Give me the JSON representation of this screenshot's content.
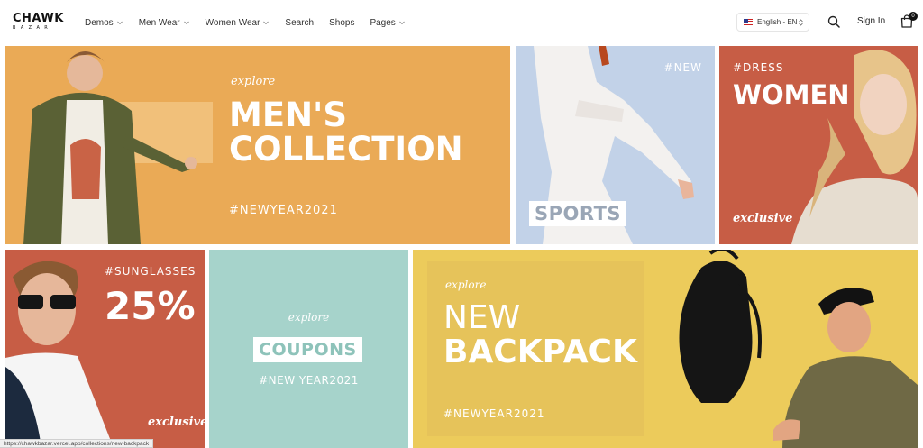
{
  "header": {
    "logo": {
      "line1": "CHAWK",
      "line2": "BAZAR"
    },
    "nav": [
      {
        "label": "Demos",
        "has_dropdown": true
      },
      {
        "label": "Men Wear",
        "has_dropdown": true
      },
      {
        "label": "Women Wear",
        "has_dropdown": true
      },
      {
        "label": "Search",
        "has_dropdown": false
      },
      {
        "label": "Shops",
        "has_dropdown": false
      },
      {
        "label": "Pages",
        "has_dropdown": true
      }
    ],
    "language": {
      "selected": "English - EN",
      "flag_icon": "us-flag-icon"
    },
    "search_icon": "search-icon",
    "sign_in_label": "Sign In",
    "cart": {
      "icon": "shopping-bag-icon",
      "count": "0"
    }
  },
  "banners": {
    "men": {
      "explore": "explore",
      "line1": "MEN'S",
      "line2": "COLLECTION",
      "tag": "#NEWYEAR2021",
      "bg": "#eaaa56"
    },
    "sports": {
      "tag": "#NEW",
      "label": "SPORTS",
      "bg": "#c2d2e8"
    },
    "women": {
      "tag": "#DRESS",
      "title": "WOMEN",
      "exclusive": "exclusive",
      "bg": "#c75d45"
    },
    "sunglasses": {
      "tag": "#SUNGLASSES",
      "percent": "25%",
      "exclusive": "exclusive",
      "bg": "#c75d45"
    },
    "coupons": {
      "explore": "explore",
      "label": "COUPONS",
      "tag": "#NEW YEAR2021",
      "bg": "#a6d3cb"
    },
    "backpack": {
      "explore": "explore",
      "line1": "NEW",
      "line2": "BACKPACK",
      "tag": "#NEWYEAR2021",
      "bg": "#eccb5b"
    }
  },
  "status_bar": {
    "url": "https://chawkbazar.vercel.app/collections/new-backpack"
  }
}
